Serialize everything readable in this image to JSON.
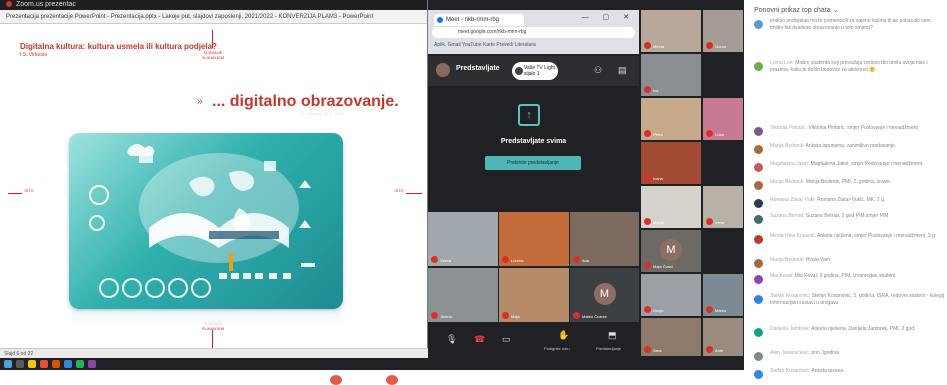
{
  "ppt": {
    "top_title": "Zoom.us prezentac",
    "title_bar": "Prezentacija prezentacije PowerPoint - Prezentacija.pptx - Lakoje put, slajdovi zaposlenji, 2021/2022 - KONVERZIJA PLAM3 - PowerPoint",
    "slide_title": "Digitalna kultura: kultura usmela ili kultura podjela?",
    "slide_sub": "I.S. Virtuoso",
    "heading_arrow": "»",
    "heading": "... digitalno obrazovanje.",
    "caption": "I.S. Virtuoso, 2021, 2022",
    "top_mark_label": "SLIKANJE SLIKANJEM",
    "bottom_mark_label": "SLIKANJE SLIKANJEM",
    "left_mark_label": "ISTO",
    "right_mark_label": "ISTO",
    "status": "Slajd 6 od 22"
  },
  "chrome": {
    "tab_title": "Meet - nkb-rmm-rbg",
    "address": "meet.google.com/nkb-rmm-rbg",
    "bookmarks": "Aplik.   Gmail   YouTube   Karte   Prevedi   Literatura",
    "window_buttons": "— ▢ ✕"
  },
  "meet": {
    "presenter_label": "Predstavljate",
    "user_chip": "Vaše TV\nLight sijalo 1",
    "panel_text": "Predstavljate svima",
    "stop_button": "Prekinite predstavljanje",
    "tiles": [
      {
        "name": "Vesna"
      },
      {
        "name": "Lorena"
      },
      {
        "name": "Ana"
      },
      {
        "name": "Jelena"
      },
      {
        "name": "Maja"
      },
      {
        "name": "Mirela"
      },
      {
        "name": "Iva"
      },
      {
        "name": "Petra"
      },
      {
        "name": "Ivana"
      },
      {
        "name": "Mateo Čvarče",
        "initial": "M"
      },
      {
        "name": "Marija"
      },
      {
        "name": "Dunja"
      },
      {
        "name": "Sara"
      },
      {
        "name": "Goran"
      },
      {
        "name": "Maja Čvarč",
        "initial": "M"
      },
      {
        "name": "Luka"
      },
      {
        "name": "Irena"
      },
      {
        "name": "Marko"
      },
      {
        "name": "Ante"
      }
    ],
    "ctrl_raise": "Podignite ruku",
    "ctrl_present": "Predstavljanje"
  },
  "chat": {
    "header": "Ponovni prikaz top chata ⌄",
    "messages": [
      {
        "name": "",
        "text": "prakso podsijelaa može pomenocili za sajene kojima ili ae pobacalo sam tmliko fali dvadese obrazovanje u tom smjeru?",
        "color": "#5b9bd5"
      },
      {
        "name": "Lorna Lori:",
        "text": "Mislim studenta koji provađuju cedovo dio umila ovoja nise i prazima, kako bi došlo bodovse za aktivnost 🙂",
        "color": "#70ad47"
      },
      {
        "name": "Viktorija Pintaric:",
        "text": "Viktorija Pintaric, smjer Poslovanje i menadžment",
        "color": "#7a5c8a"
      },
      {
        "name": "Marija Bedenik:",
        "text": "Anketa ispunjena, zanimljivo predavanje.",
        "color": "#a66b3b"
      },
      {
        "name": "Magdalena Jakin:",
        "text": "Magdalena Jakin, smjer Poslovanje i menadžment",
        "color": "#c55a5a"
      },
      {
        "name": "Marija Bedenik:",
        "text": "Marija Bedenik, PMI, 2. godina, izvanr.",
        "color": "#a66b3b"
      },
      {
        "name": "Romana Zlatar-Vuki:",
        "text": "Romana Zlatar-Vukić, MK, 2 g.",
        "color": "#2f3c4c"
      },
      {
        "name": "Suzana Bernat:",
        "text": "Suzana Bernat, 2 god PIM smjer PIM",
        "color": "#3c6e71"
      },
      {
        "name": "Mirela Hina Krizanić:",
        "text": "Anketa riješena, smjer Poslovanje i menadžment, 2.g",
        "color": "#c0392b"
      },
      {
        "name": "Marija Bedenik:",
        "text": "Hvala Vam",
        "color": "#a66b3b"
      },
      {
        "name": "Mia Koval:",
        "text": "Mia Koval, 3 godina, PIM, izvanredan student",
        "color": "#8e44ad"
      },
      {
        "name": "Stefan Kosanović:",
        "text": "Stefan Kosanović, 3. godina, ISRA, redovni student - kolegij Informacijski sustavi u drugavu",
        "color": "#2e86de"
      },
      {
        "name": "Danijela Jambrek:",
        "text": "Anketa riješena, Danijela Jambrek, PMI, 2 god.",
        "color": "#16a085"
      },
      {
        "name": "Alen Jankovčević:",
        "text": "prin 3godina",
        "color": "#7f8c8d"
      },
      {
        "name": "Stefan Kosanović:",
        "text": "Anketa ipsana",
        "color": "#2e86de"
      }
    ]
  }
}
